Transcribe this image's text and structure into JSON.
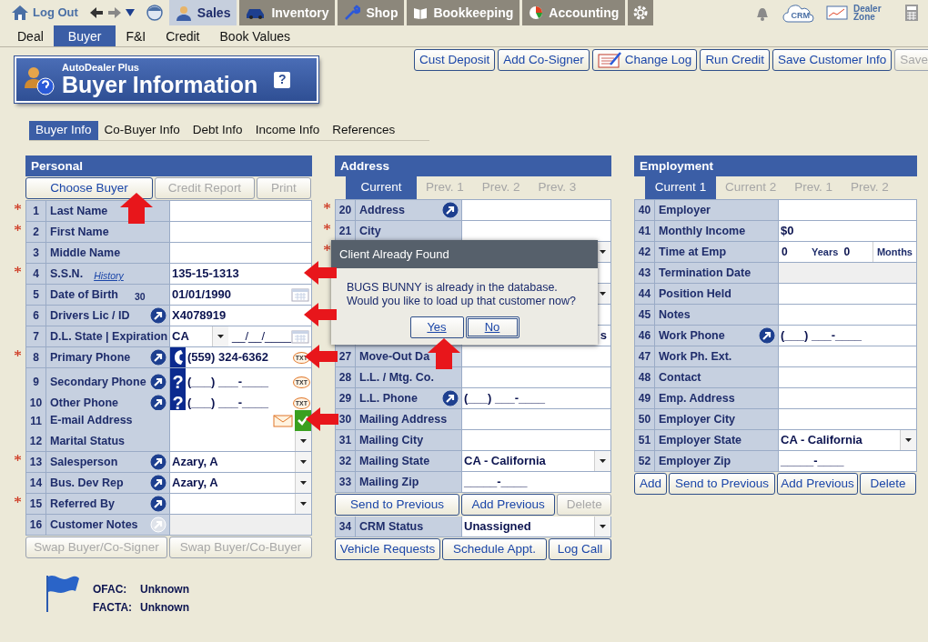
{
  "nav": {
    "logout": "Log Out",
    "modules": [
      {
        "label": "Sales",
        "selected": true
      },
      {
        "label": "Inventory",
        "selected": false
      },
      {
        "label": "Shop",
        "selected": false
      },
      {
        "label": "Bookkeeping",
        "selected": false
      },
      {
        "label": "Accounting",
        "selected": false
      }
    ],
    "crm": "CRM",
    "dealer_zone": "Dealer Zone"
  },
  "subtabs": [
    {
      "label": "Deal",
      "selected": false
    },
    {
      "label": "Buyer",
      "selected": true
    },
    {
      "label": "F&I",
      "selected": false
    },
    {
      "label": "Credit",
      "selected": false
    },
    {
      "label": "Book Values",
      "selected": false
    }
  ],
  "actions": [
    {
      "label": "Cust Deposit",
      "kind": "plain",
      "disabled": false
    },
    {
      "label": "Add Co-Signer",
      "kind": "plain",
      "disabled": false
    },
    {
      "label": "Change Log",
      "kind": "iconed",
      "disabled": false
    },
    {
      "label": "Run Credit",
      "kind": "plain",
      "disabled": false
    },
    {
      "label": "Save Customer Info",
      "kind": "plain",
      "disabled": false
    },
    {
      "label": "Save",
      "kind": "plain",
      "disabled": true
    }
  ],
  "banner": {
    "brand": "AutoDealer Plus",
    "title": "Buyer Information",
    "help": "?"
  },
  "tabs": [
    {
      "label": "Buyer Info",
      "selected": true
    },
    {
      "label": "Co-Buyer Info",
      "selected": false
    },
    {
      "label": "Debt Info",
      "selected": false
    },
    {
      "label": "Income Info",
      "selected": false
    },
    {
      "label": "References",
      "selected": false
    }
  ],
  "personal": {
    "title": "Personal",
    "buttons": [
      {
        "label": "Choose Buyer",
        "disabled": false
      },
      {
        "label": "Credit Report",
        "disabled": true
      },
      {
        "label": "Print",
        "disabled": true
      }
    ],
    "rows": [
      {
        "num": "1",
        "label": "Last Name",
        "required": true,
        "kind": "text"
      },
      {
        "num": "2",
        "label": "First Name",
        "required": true,
        "kind": "text"
      },
      {
        "num": "3",
        "label": "Middle Name",
        "required": false,
        "kind": "text"
      },
      {
        "num": "4",
        "label": "S.S.N.",
        "note": "History",
        "required": true,
        "kind": "text",
        "value": "135-15-1313"
      },
      {
        "num": "5",
        "label": "Date of Birth",
        "age": "30",
        "required": false,
        "kind": "date",
        "value": "01/01/1990"
      },
      {
        "num": "6",
        "label": "Drivers Lic / ID",
        "link_enabled": true,
        "required": false,
        "kind": "text",
        "value": "X4078919"
      },
      {
        "num": "7",
        "label": "D.L. State | Expiration",
        "required": false,
        "kind": "state-date",
        "value": "CA",
        "date": "__/__/____"
      },
      {
        "num": "8",
        "label": "Primary Phone",
        "link_enabled": true,
        "required": true,
        "kind": "phone",
        "value": "(559) 324-6362",
        "sms": "TXT"
      },
      {
        "num": "9",
        "label": "Secondary Phone",
        "link_enabled": true,
        "required": false,
        "kind": "phone",
        "line_mark": "?",
        "value": "(___) ___-____",
        "sms": "TXT"
      },
      {
        "num": "10",
        "label": "Other Phone",
        "link_enabled": true,
        "required": false,
        "kind": "phone",
        "line_mark": "?",
        "value": "(___) ___-____",
        "sms": "TXT"
      },
      {
        "num": "11",
        "label": "E-mail Address",
        "required": false,
        "kind": "email",
        "verified": true
      },
      {
        "num": "12",
        "label": "Marital Status",
        "required": false,
        "kind": "select"
      },
      {
        "num": "13",
        "label": "Salesperson",
        "link_enabled": true,
        "required": true,
        "kind": "select",
        "value": "Azary, A"
      },
      {
        "num": "14",
        "label": "Bus. Dev Rep",
        "link_enabled": true,
        "required": false,
        "kind": "select",
        "value": "Azary, A"
      },
      {
        "num": "15",
        "label": "Referred By",
        "link_enabled": true,
        "required": true,
        "kind": "select"
      },
      {
        "num": "16",
        "label": "Customer Notes",
        "link_enabled": false,
        "required": false,
        "kind": "disabled"
      }
    ],
    "bottom_buttons": [
      {
        "label": "Swap Buyer/Co-Signer",
        "disabled": true
      },
      {
        "label": "Swap Buyer/Co-Buyer",
        "disabled": true
      }
    ]
  },
  "address": {
    "title": "Address",
    "tabs": [
      {
        "label": "Current",
        "selected": true
      },
      {
        "label": "Prev. 1",
        "selected": false
      },
      {
        "label": "Prev. 2",
        "selected": false
      },
      {
        "label": "Prev. 3",
        "selected": false
      }
    ],
    "rows": [
      {
        "num": "20",
        "label": "Address",
        "link_enabled": true,
        "required": true,
        "kind": "text"
      },
      {
        "num": "21",
        "label": "City",
        "required": true,
        "kind": "text"
      },
      {
        "required": true,
        "kind": "select"
      },
      {
        "required": false,
        "kind": "text"
      },
      {
        "required": false,
        "kind": "select"
      },
      {
        "required": false,
        "kind": "text"
      },
      {
        "required": false,
        "kind": "fragment",
        "value": "s"
      },
      {
        "num": "27",
        "label": "Move-Out Da",
        "required": false,
        "kind": "text"
      },
      {
        "num": "28",
        "label": "L.L. / Mtg. Co.",
        "required": false,
        "kind": "text"
      },
      {
        "num": "29",
        "label": "L.L. Phone",
        "link_enabled": true,
        "required": false,
        "kind": "text",
        "value": "(___) ___-____"
      },
      {
        "num": "30",
        "label": "Mailing Address",
        "required": false,
        "kind": "text"
      },
      {
        "num": "31",
        "label": "Mailing City",
        "required": false,
        "kind": "text"
      },
      {
        "num": "32",
        "label": "Mailing State",
        "required": false,
        "kind": "select",
        "value": "CA - California"
      },
      {
        "num": "33",
        "label": "Mailing Zip",
        "required": false,
        "kind": "text",
        "value": "_____-____"
      }
    ],
    "buttons": [
      {
        "label": "Send to Previous",
        "disabled": false
      },
      {
        "label": "Add Previous",
        "disabled": false
      },
      {
        "label": "Delete",
        "disabled": true
      }
    ],
    "status_row": {
      "num": "34",
      "label": "CRM Status",
      "required": false,
      "kind": "select",
      "value": "Unassigned"
    },
    "bottom_buttons": [
      {
        "label": "Vehicle Requests",
        "disabled": false
      },
      {
        "label": "Schedule Appt.",
        "disabled": false
      },
      {
        "label": "Log Call",
        "disabled": false
      }
    ]
  },
  "employment": {
    "title": "Employment",
    "tabs": [
      {
        "label": "Current 1",
        "selected": true
      },
      {
        "label": "Current 2",
        "selected": false
      },
      {
        "label": "Prev. 1",
        "selected": false
      },
      {
        "label": "Prev. 2",
        "selected": false
      }
    ],
    "rows": [
      {
        "num": "40",
        "label": "Employer",
        "kind": "text"
      },
      {
        "num": "41",
        "label": "Monthly Income",
        "kind": "text",
        "value": "$0"
      },
      {
        "num": "42",
        "label": "Time at Emp",
        "kind": "duration",
        "years": "0",
        "years_unit": "Years",
        "months": "0",
        "months_unit": "Months"
      },
      {
        "num": "43",
        "label": "Termination Date",
        "kind": "disabled"
      },
      {
        "num": "44",
        "label": "Position Held",
        "kind": "text"
      },
      {
        "num": "45",
        "label": "Notes",
        "kind": "text"
      },
      {
        "num": "46",
        "label": "Work Phone",
        "link_enabled": true,
        "kind": "text",
        "value": "(___) ___-____"
      },
      {
        "num": "47",
        "label": "Work Ph. Ext.",
        "kind": "text"
      },
      {
        "num": "48",
        "label": "Contact",
        "kind": "text"
      },
      {
        "num": "49",
        "label": "Emp. Address",
        "kind": "text"
      },
      {
        "num": "50",
        "label": "Employer City",
        "kind": "text"
      },
      {
        "num": "51",
        "label": "Employer State",
        "kind": "select",
        "value": "CA - California"
      },
      {
        "num": "52",
        "label": "Employer Zip",
        "kind": "text",
        "value": "_____-____"
      }
    ],
    "buttons": [
      {
        "label": "Add",
        "disabled": false
      },
      {
        "label": "Send to Previous",
        "disabled": false
      },
      {
        "label": "Add Previous",
        "disabled": false
      },
      {
        "label": "Delete",
        "disabled": false
      }
    ]
  },
  "dialog": {
    "title": "Client Already Found",
    "lines": [
      "BUGS BUNNY is already in the database.",
      "Would you like to load up that customer now?"
    ],
    "buttons": [
      {
        "label": "Yes",
        "focused": false
      },
      {
        "label": "No",
        "focused": true
      }
    ]
  },
  "screening": [
    {
      "label": "OFAC:",
      "value": "Unknown"
    },
    {
      "label": "FACTA:",
      "value": "Unknown"
    }
  ]
}
